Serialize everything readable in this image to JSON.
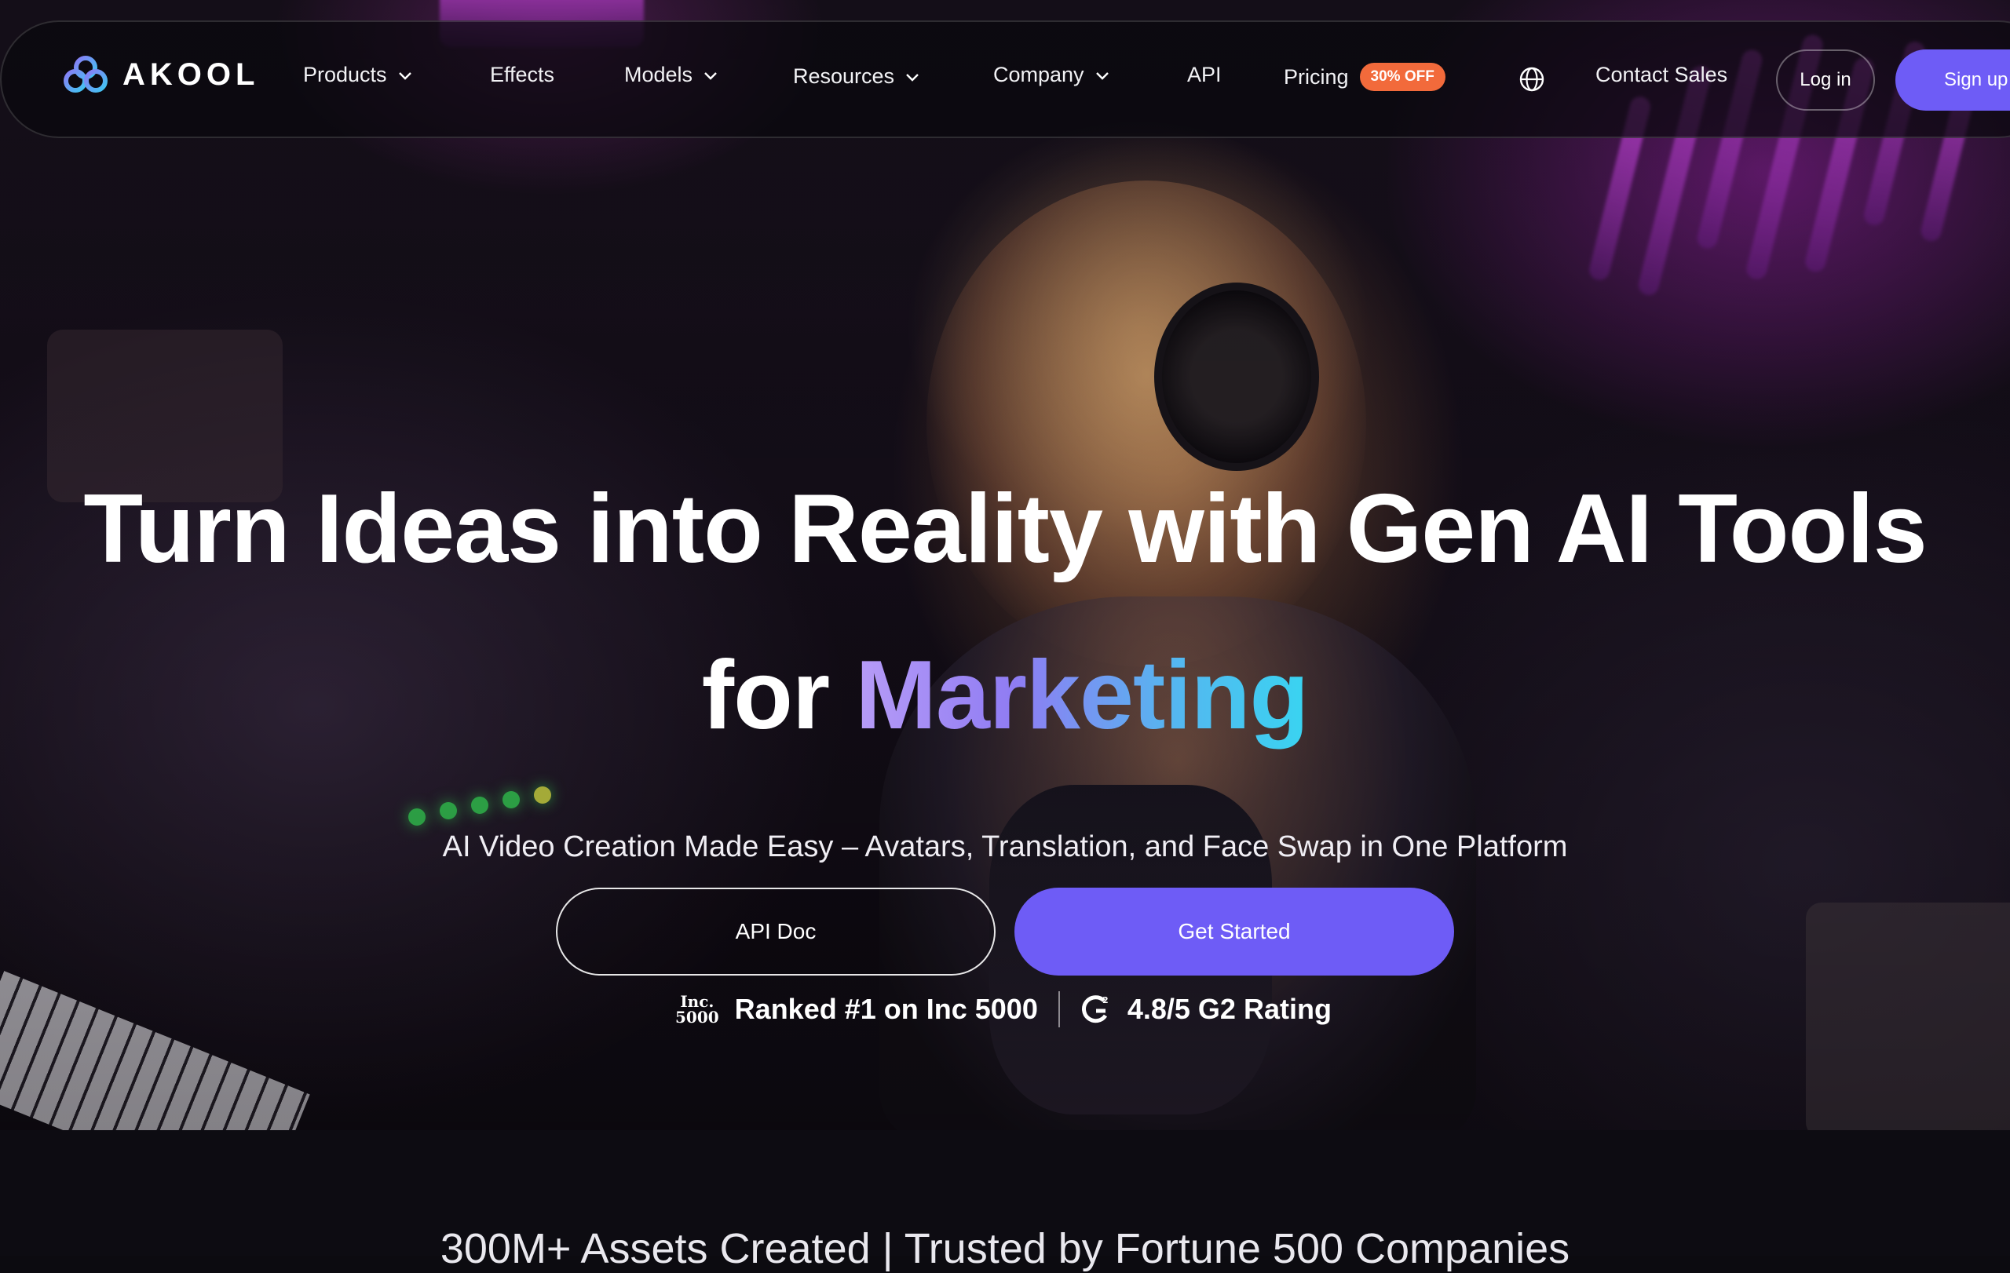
{
  "brand": {
    "name": "AKOOL",
    "accent_color": "#6e5cf6",
    "badge_color": "#f26a3b"
  },
  "nav": {
    "items": [
      {
        "label": "Products",
        "has_dropdown": true
      },
      {
        "label": "Effects",
        "has_dropdown": false
      },
      {
        "label": "Models",
        "has_dropdown": true
      },
      {
        "label": "Resources",
        "has_dropdown": true
      },
      {
        "label": "Company",
        "has_dropdown": true
      },
      {
        "label": "API",
        "has_dropdown": false
      },
      {
        "label": "Pricing",
        "has_dropdown": false
      }
    ],
    "pricing_badge": "30% OFF",
    "language_icon": "globe-icon",
    "contact_sales": "Contact Sales",
    "login": "Log in",
    "signup": "Sign up"
  },
  "hero": {
    "headline_line1": "Turn Ideas into Reality with Gen AI Tools",
    "headline_for": "for",
    "headline_accent": "Marketing",
    "subtitle": "AI Video Creation Made Easy – Avatars, Translation, and Face Swap in One Platform",
    "api_doc_button": "API Doc",
    "get_started_button": "Get Started",
    "inc_logo_line1": "Inc.",
    "inc_logo_line2": "5000",
    "inc_text": "Ranked #1 on Inc 5000",
    "g2_text": "4.8/5 G2 Rating"
  },
  "trust_line": "300M+ Assets Created | Trusted by Fortune 500 Companies"
}
